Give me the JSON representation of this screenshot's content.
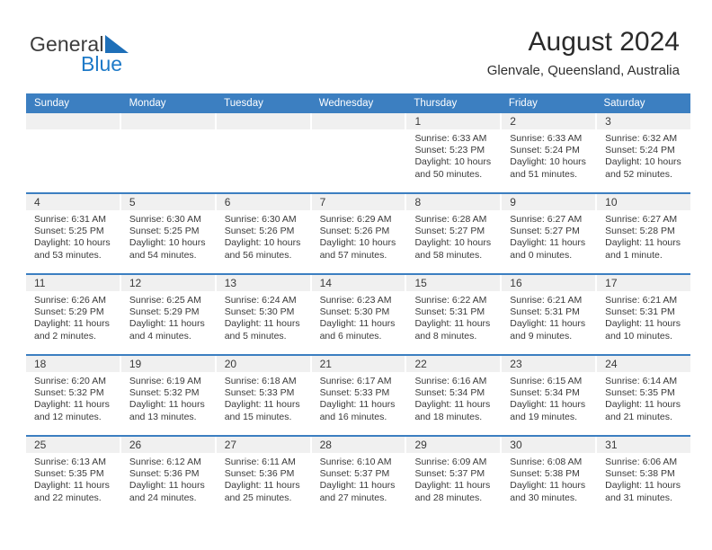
{
  "brand": {
    "word_top": "General",
    "word_bottom": "Blue",
    "accent_color": "#1e7ac8",
    "triangle_color": "#1e6fb8"
  },
  "header": {
    "title": "August 2024",
    "subtitle": "Glenvale, Queensland, Australia"
  },
  "theme": {
    "header_blue": "#3c7fc1",
    "daynum_band": "#f0f0f0",
    "text": "#3a3a3a"
  },
  "weekdays": [
    "Sunday",
    "Monday",
    "Tuesday",
    "Wednesday",
    "Thursday",
    "Friday",
    "Saturday"
  ],
  "weeks": [
    [
      {
        "day": "",
        "lines": []
      },
      {
        "day": "",
        "lines": []
      },
      {
        "day": "",
        "lines": []
      },
      {
        "day": "",
        "lines": []
      },
      {
        "day": "1",
        "lines": [
          "Sunrise: 6:33 AM",
          "Sunset: 5:23 PM",
          "Daylight: 10 hours",
          "and 50 minutes."
        ]
      },
      {
        "day": "2",
        "lines": [
          "Sunrise: 6:33 AM",
          "Sunset: 5:24 PM",
          "Daylight: 10 hours",
          "and 51 minutes."
        ]
      },
      {
        "day": "3",
        "lines": [
          "Sunrise: 6:32 AM",
          "Sunset: 5:24 PM",
          "Daylight: 10 hours",
          "and 52 minutes."
        ]
      }
    ],
    [
      {
        "day": "4",
        "lines": [
          "Sunrise: 6:31 AM",
          "Sunset: 5:25 PM",
          "Daylight: 10 hours",
          "and 53 minutes."
        ]
      },
      {
        "day": "5",
        "lines": [
          "Sunrise: 6:30 AM",
          "Sunset: 5:25 PM",
          "Daylight: 10 hours",
          "and 54 minutes."
        ]
      },
      {
        "day": "6",
        "lines": [
          "Sunrise: 6:30 AM",
          "Sunset: 5:26 PM",
          "Daylight: 10 hours",
          "and 56 minutes."
        ]
      },
      {
        "day": "7",
        "lines": [
          "Sunrise: 6:29 AM",
          "Sunset: 5:26 PM",
          "Daylight: 10 hours",
          "and 57 minutes."
        ]
      },
      {
        "day": "8",
        "lines": [
          "Sunrise: 6:28 AM",
          "Sunset: 5:27 PM",
          "Daylight: 10 hours",
          "and 58 minutes."
        ]
      },
      {
        "day": "9",
        "lines": [
          "Sunrise: 6:27 AM",
          "Sunset: 5:27 PM",
          "Daylight: 11 hours",
          "and 0 minutes."
        ]
      },
      {
        "day": "10",
        "lines": [
          "Sunrise: 6:27 AM",
          "Sunset: 5:28 PM",
          "Daylight: 11 hours",
          "and 1 minute."
        ]
      }
    ],
    [
      {
        "day": "11",
        "lines": [
          "Sunrise: 6:26 AM",
          "Sunset: 5:29 PM",
          "Daylight: 11 hours",
          "and 2 minutes."
        ]
      },
      {
        "day": "12",
        "lines": [
          "Sunrise: 6:25 AM",
          "Sunset: 5:29 PM",
          "Daylight: 11 hours",
          "and 4 minutes."
        ]
      },
      {
        "day": "13",
        "lines": [
          "Sunrise: 6:24 AM",
          "Sunset: 5:30 PM",
          "Daylight: 11 hours",
          "and 5 minutes."
        ]
      },
      {
        "day": "14",
        "lines": [
          "Sunrise: 6:23 AM",
          "Sunset: 5:30 PM",
          "Daylight: 11 hours",
          "and 6 minutes."
        ]
      },
      {
        "day": "15",
        "lines": [
          "Sunrise: 6:22 AM",
          "Sunset: 5:31 PM",
          "Daylight: 11 hours",
          "and 8 minutes."
        ]
      },
      {
        "day": "16",
        "lines": [
          "Sunrise: 6:21 AM",
          "Sunset: 5:31 PM",
          "Daylight: 11 hours",
          "and 9 minutes."
        ]
      },
      {
        "day": "17",
        "lines": [
          "Sunrise: 6:21 AM",
          "Sunset: 5:31 PM",
          "Daylight: 11 hours",
          "and 10 minutes."
        ]
      }
    ],
    [
      {
        "day": "18",
        "lines": [
          "Sunrise: 6:20 AM",
          "Sunset: 5:32 PM",
          "Daylight: 11 hours",
          "and 12 minutes."
        ]
      },
      {
        "day": "19",
        "lines": [
          "Sunrise: 6:19 AM",
          "Sunset: 5:32 PM",
          "Daylight: 11 hours",
          "and 13 minutes."
        ]
      },
      {
        "day": "20",
        "lines": [
          "Sunrise: 6:18 AM",
          "Sunset: 5:33 PM",
          "Daylight: 11 hours",
          "and 15 minutes."
        ]
      },
      {
        "day": "21",
        "lines": [
          "Sunrise: 6:17 AM",
          "Sunset: 5:33 PM",
          "Daylight: 11 hours",
          "and 16 minutes."
        ]
      },
      {
        "day": "22",
        "lines": [
          "Sunrise: 6:16 AM",
          "Sunset: 5:34 PM",
          "Daylight: 11 hours",
          "and 18 minutes."
        ]
      },
      {
        "day": "23",
        "lines": [
          "Sunrise: 6:15 AM",
          "Sunset: 5:34 PM",
          "Daylight: 11 hours",
          "and 19 minutes."
        ]
      },
      {
        "day": "24",
        "lines": [
          "Sunrise: 6:14 AM",
          "Sunset: 5:35 PM",
          "Daylight: 11 hours",
          "and 21 minutes."
        ]
      }
    ],
    [
      {
        "day": "25",
        "lines": [
          "Sunrise: 6:13 AM",
          "Sunset: 5:35 PM",
          "Daylight: 11 hours",
          "and 22 minutes."
        ]
      },
      {
        "day": "26",
        "lines": [
          "Sunrise: 6:12 AM",
          "Sunset: 5:36 PM",
          "Daylight: 11 hours",
          "and 24 minutes."
        ]
      },
      {
        "day": "27",
        "lines": [
          "Sunrise: 6:11 AM",
          "Sunset: 5:36 PM",
          "Daylight: 11 hours",
          "and 25 minutes."
        ]
      },
      {
        "day": "28",
        "lines": [
          "Sunrise: 6:10 AM",
          "Sunset: 5:37 PM",
          "Daylight: 11 hours",
          "and 27 minutes."
        ]
      },
      {
        "day": "29",
        "lines": [
          "Sunrise: 6:09 AM",
          "Sunset: 5:37 PM",
          "Daylight: 11 hours",
          "and 28 minutes."
        ]
      },
      {
        "day": "30",
        "lines": [
          "Sunrise: 6:08 AM",
          "Sunset: 5:38 PM",
          "Daylight: 11 hours",
          "and 30 minutes."
        ]
      },
      {
        "day": "31",
        "lines": [
          "Sunrise: 6:06 AM",
          "Sunset: 5:38 PM",
          "Daylight: 11 hours",
          "and 31 minutes."
        ]
      }
    ]
  ]
}
